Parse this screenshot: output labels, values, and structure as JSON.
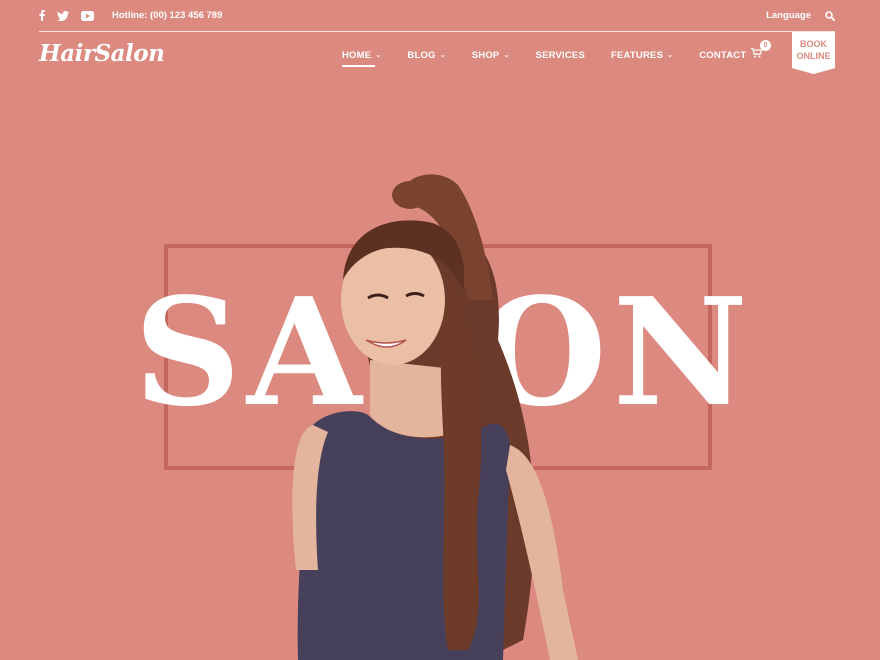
{
  "topbar": {
    "social": [
      {
        "name": "facebook-icon"
      },
      {
        "name": "twitter-icon"
      },
      {
        "name": "youtube-icon"
      }
    ],
    "hotline": "Hotline: (00) 123 456 789",
    "language": "Language",
    "search_icon": "search-icon"
  },
  "header": {
    "logo": "HairSalon",
    "nav": [
      {
        "label": "HOME",
        "dropdown": true,
        "active": true
      },
      {
        "label": "BLOG",
        "dropdown": true
      },
      {
        "label": "SHOP",
        "dropdown": true
      },
      {
        "label": "SERVICES",
        "dropdown": false
      },
      {
        "label": "FEATURES",
        "dropdown": true
      },
      {
        "label": "CONTACT",
        "dropdown": false
      }
    ],
    "cart_count": "0",
    "book_line1": "BOOK",
    "book_line2": "ONLINE"
  },
  "hero": {
    "word": "SALON"
  },
  "colors": {
    "background": "#dc8a80",
    "frame": "#c4675f",
    "text": "#ffffff"
  }
}
